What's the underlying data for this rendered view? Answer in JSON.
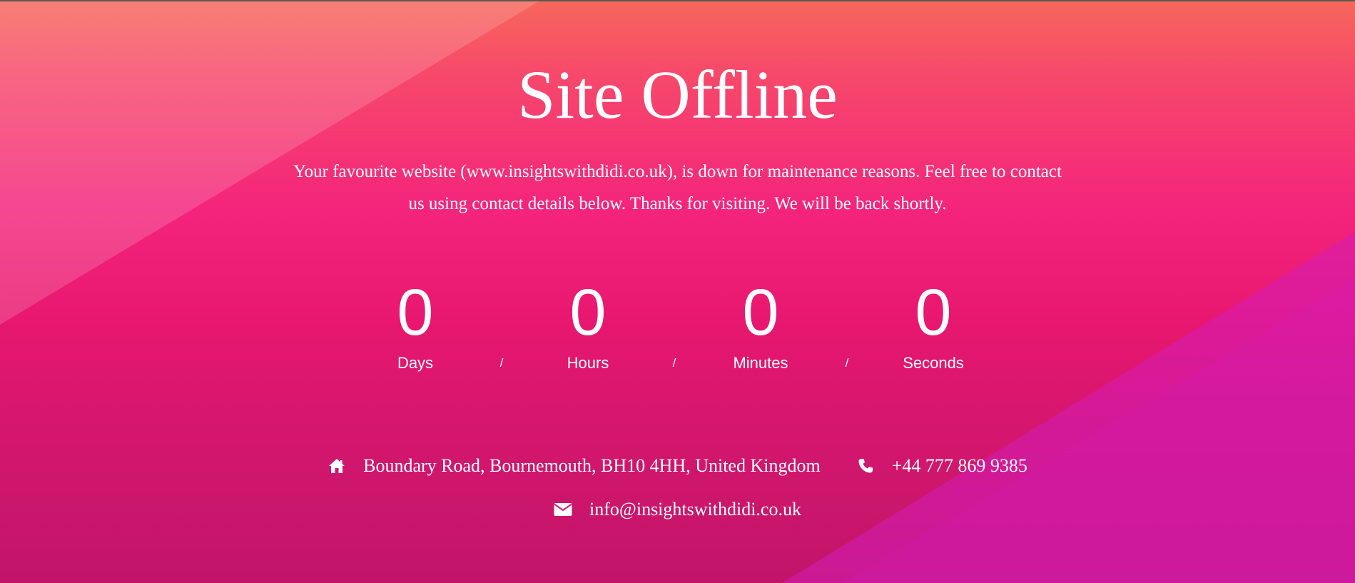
{
  "page": {
    "title": "Site Offline",
    "message": "Your favourite website (www.insightswithdidi.co.uk), is down for maintenance reasons. Feel free to contact us using contact details below. Thanks for visiting. We will be back shortly."
  },
  "countdown": {
    "days": {
      "value": "0",
      "label": "Days"
    },
    "hours": {
      "value": "0",
      "label": "Hours"
    },
    "minutes": {
      "value": "0",
      "label": "Minutes"
    },
    "seconds": {
      "value": "0",
      "label": "Seconds"
    },
    "separator": "/"
  },
  "contact": {
    "address": "Boundary Road, Bournemouth, BH10 4HH, United Kingdom",
    "address_icon": "home-icon",
    "phone": "+44 777 869 9385",
    "phone_icon": "phone-icon",
    "email": "info@insightswithdidi.co.uk",
    "email_icon": "envelope-icon"
  },
  "colors": {
    "gradient_top": "#f7675a",
    "gradient_mid": "#f4247c",
    "gradient_bottom": "#c11569",
    "text": "#ffffff"
  }
}
